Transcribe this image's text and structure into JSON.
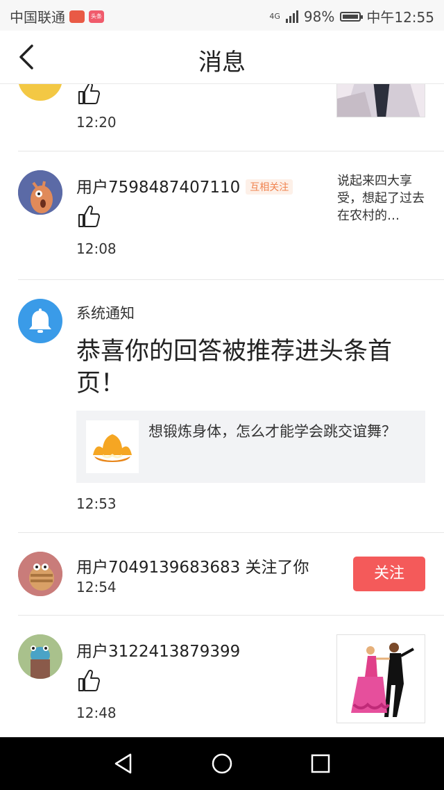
{
  "status_bar": {
    "carrier": "中国联通",
    "app_badge": "头条",
    "network": "4G",
    "battery": "98%",
    "time": "中午12:55"
  },
  "header": {
    "title": "消息",
    "back_icon": "chevron-left-icon"
  },
  "messages": [
    {
      "type": "like",
      "time": "12:20",
      "partial": true
    },
    {
      "type": "like",
      "user": "用户7598487407110",
      "badge": "互相关注",
      "time": "12:08",
      "snippet": "说起来四大享受，想起了过去在农村的…"
    },
    {
      "type": "system",
      "label": "系统通知",
      "message": "恭喜你的回答被推荐进头条首页！",
      "quote": "想锻炼身体，怎么才能学会跳交谊舞？",
      "time": "12:53"
    },
    {
      "type": "follow",
      "user": "用户7049139683683",
      "action": "关注了你",
      "time": "12:54",
      "button": "关注"
    },
    {
      "type": "like",
      "user": "用户3122413879399",
      "time": "12:48"
    }
  ],
  "colors": {
    "accent_red": "#f45a5a",
    "mutual_badge": "#f0834f",
    "system_icon_bg": "#3a9be8"
  }
}
